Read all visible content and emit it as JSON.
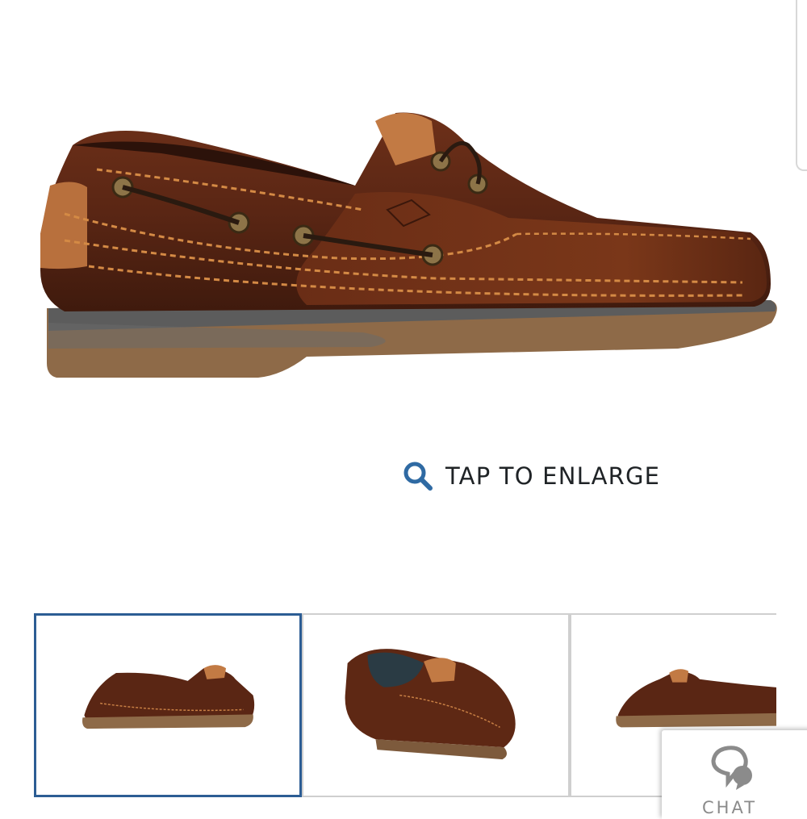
{
  "enlarge": {
    "label": "TAP TO ENLARGE",
    "icon": "search-icon",
    "icon_color": "#2f6aa3"
  },
  "thumbnails": [
    {
      "view": "side",
      "selected": true
    },
    {
      "view": "three-quarter",
      "selected": false
    },
    {
      "view": "side-partial",
      "selected": false
    }
  ],
  "chat": {
    "label": "CHAT",
    "icon": "chat-bubble-icon"
  },
  "colors": {
    "selected_border": "#2c5d94",
    "leather": "#5e2a17",
    "sole": "#8a6644",
    "stitching": "#d48a45"
  }
}
